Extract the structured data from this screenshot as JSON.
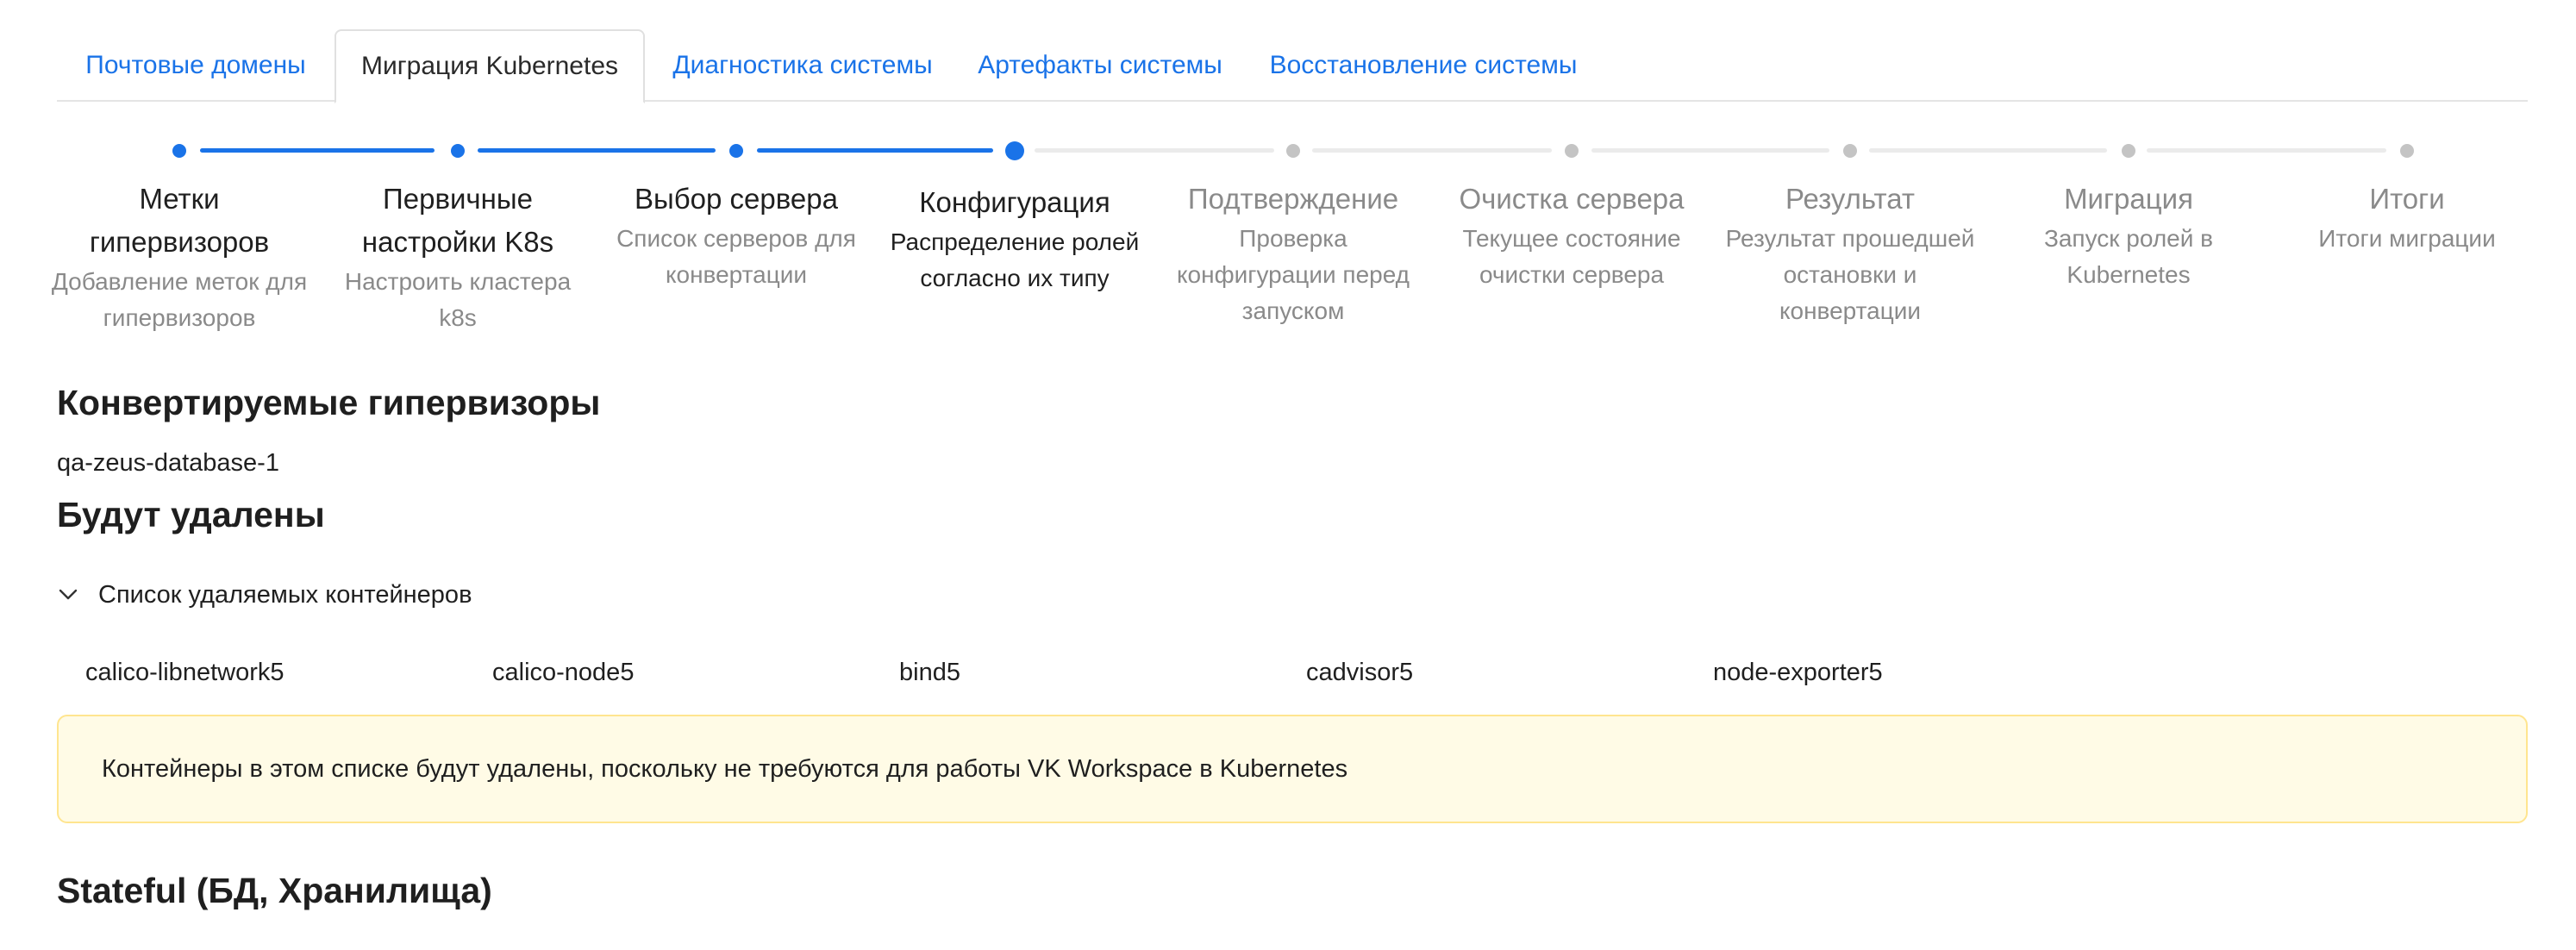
{
  "tabs": [
    {
      "label": "Почтовые домены",
      "active": false
    },
    {
      "label": "Миграция Kubernetes",
      "active": true
    },
    {
      "label": "Диагностика системы",
      "active": false
    },
    {
      "label": "Артефакты системы",
      "active": false
    },
    {
      "label": "Восстановление системы",
      "active": false
    }
  ],
  "steps": [
    {
      "title": "Метки гипервизоров",
      "desc": "Добавление меток для гипервизоров",
      "status": "done"
    },
    {
      "title": "Первичные настройки K8s",
      "desc": "Настроить кластера k8s",
      "status": "done"
    },
    {
      "title": "Выбор сервера",
      "desc": "Список серверов для конвертации",
      "status": "done"
    },
    {
      "title": "Конфигурация",
      "desc": "Распределение ролей согласно их типу",
      "status": "current"
    },
    {
      "title": "Подтверждение",
      "desc": "Проверка конфигурации перед запуском",
      "status": "todo"
    },
    {
      "title": "Очистка сервера",
      "desc": "Текущее состояние очистки сервера",
      "status": "todo"
    },
    {
      "title": "Результат",
      "desc": "Результат прошедшей остановки и конвертации",
      "status": "todo"
    },
    {
      "title": "Миграция",
      "desc": "Запуск ролей в Kubernetes",
      "status": "todo"
    },
    {
      "title": "Итоги",
      "desc": "Итоги миграции",
      "status": "todo"
    }
  ],
  "hypervisors": {
    "heading": "Конвертируемые гипервизоры",
    "items": [
      "qa-zeus-database-1"
    ]
  },
  "removed": {
    "heading": "Будут удалены",
    "collapse_title": "Список удаляемых контейнеров",
    "containers": [
      "calico-libnetwork5",
      "calico-node5",
      "bind5",
      "cadvisor5",
      "node-exporter5"
    ],
    "alert": "Контейнеры в этом списке будут удалены, поскольку не требуются для работы VK Workspace в Kubernetes"
  },
  "stateful": {
    "heading": "Stateful (БД, Хранилища)"
  },
  "colors": {
    "accent": "#1a73e8",
    "inactive": "#c4c4c4",
    "alert_bg": "#fffbe6",
    "alert_border": "#ffe58f"
  }
}
